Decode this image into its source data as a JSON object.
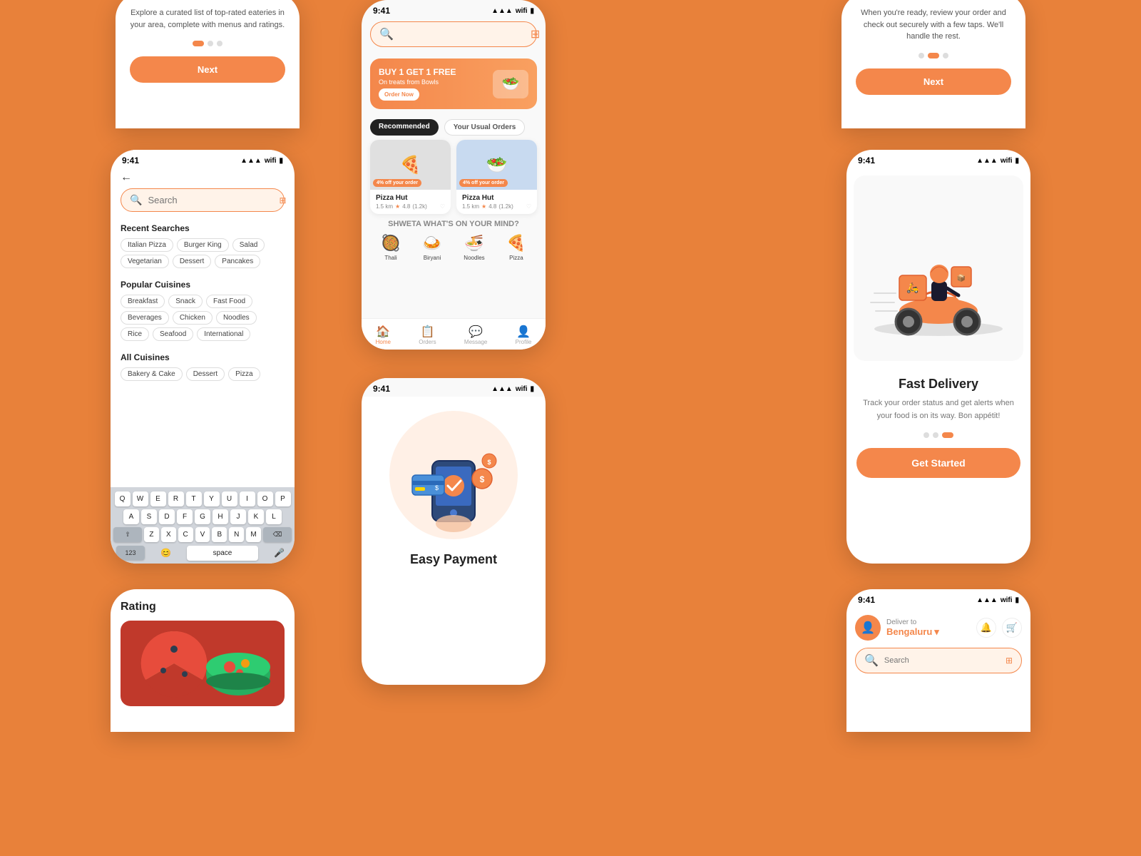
{
  "colors": {
    "primary": "#F4874B",
    "background": "#E8813A",
    "white": "#ffffff",
    "dark": "#222222",
    "gray": "#888888",
    "light_bg": "#f9f9f9"
  },
  "phone_search": {
    "status_time": "9:41",
    "search_placeholder": "Search",
    "recent_searches_title": "Recent Searches",
    "recent_tags": [
      "Italian Pizza",
      "Burger King",
      "Salad",
      "Vegetarian",
      "Dessert",
      "Pancakes"
    ],
    "popular_cuisines_title": "Popular Cuisines",
    "popular_tags": [
      "Breakfast",
      "Snack",
      "Fast Food",
      "Beverages",
      "Chicken",
      "Noodles",
      "Rice",
      "Seafood",
      "International"
    ],
    "all_cuisines_title": "All Cuisines",
    "all_tags": [
      "Bakery & Cake",
      "Dessert",
      "Pizza"
    ],
    "keyboard_rows": [
      [
        "Q",
        "W",
        "E",
        "R",
        "T",
        "Y",
        "U",
        "I",
        "O",
        "P"
      ],
      [
        "A",
        "S",
        "D",
        "F",
        "G",
        "H",
        "J",
        "K",
        "L"
      ],
      [
        "⇧",
        "Z",
        "X",
        "C",
        "V",
        "B",
        "N",
        "M",
        "⌫"
      ],
      [
        "123",
        "space"
      ]
    ]
  },
  "phone_home": {
    "status_time": "9:41",
    "promo_title": "BUY 1 GET 1 FREE",
    "promo_sub": "On treats from Bowls",
    "promo_btn": "Order Now",
    "tab_recommended": "Recommended",
    "tab_usual": "Your Usual Orders",
    "restaurants": [
      {
        "name": "Pizza Hut",
        "distance": "1.5 km",
        "rating": "4.8",
        "reviews": "1.2k",
        "discount": "4% off your order"
      },
      {
        "name": "Pizza Hut",
        "distance": "1.5 km",
        "rating": "4.8",
        "reviews": "1.2k",
        "discount": "4% off your order"
      }
    ],
    "shweta_section": "SHWETA WHAT'S ON YOUR MIND?",
    "food_items": [
      {
        "emoji": "🥘",
        "label": "Thali"
      },
      {
        "emoji": "🍛",
        "label": "Biryani"
      },
      {
        "emoji": "🍜",
        "label": "Noodles"
      },
      {
        "emoji": "🍕",
        "label": "Pizza"
      }
    ],
    "nav_items": [
      "Home",
      "Orders",
      "Message",
      "Profile"
    ]
  },
  "phone_onboard_left": {
    "description": "Explore a curated list of top-rated eateries in your area, complete with menus and ratings.",
    "next_btn": "Next"
  },
  "phone_delivery": {
    "status_time": "9:41",
    "title": "Fast Delivery",
    "description": "Track your order status and get alerts when your food is on its way. Bon appétit!",
    "get_started_btn": "Get Started"
  },
  "phone_onboard_right": {
    "description": "When you're ready, review your order and check out securely with a few taps. We'll handle the rest.",
    "next_btn": "Next"
  },
  "phone_payment": {
    "status_time": "9:41",
    "title": "Easy Payment"
  },
  "phone_rating": {
    "title": "Rating"
  },
  "phone_address": {
    "status_time": "9:41",
    "deliver_to": "Deliver to",
    "city": "Bengaluru",
    "search_placeholder": "Search"
  }
}
